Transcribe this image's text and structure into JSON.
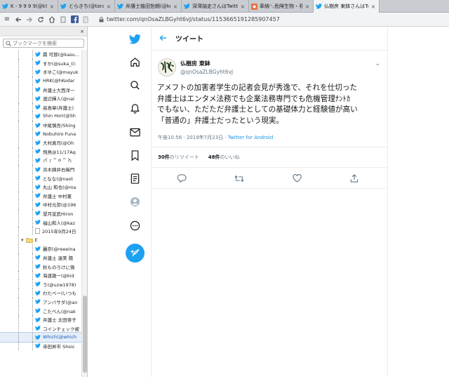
{
  "tabs": [
    {
      "title": "K - 9 9 9 9(@k9999... ",
      "icon": "twitter-icon",
      "active": false
    },
    {
      "title": "とらきち(@torakit0ex",
      "icon": "twitter-icon",
      "active": false
    },
    {
      "title": "弁護士植田哲朗(@ke",
      "icon": "twitter-icon",
      "active": false
    },
    {
      "title": "深澤諭史さんはTwitt",
      "icon": "twitter-icon",
      "active": false
    },
    {
      "title": "奉納＼危険生物・非ロ",
      "icon": "page-icon",
      "active": false
    },
    {
      "title": "仏樹房 東鉢さんはTw",
      "icon": "twitter-icon",
      "active": true
    }
  ],
  "url": "twitter.com/qnOsaZLBGyht6vJ/status/1153665191285907457",
  "sidebar": {
    "search_placeholder": "ブックマークを検索",
    "items": [
      {
        "label": "霧 可那(@kasu...",
        "type": "bookmark"
      },
      {
        "label": "すか(@suka_t):",
        "type": "bookmark"
      },
      {
        "label": "まゆこ(@mayuk",
        "type": "bookmark"
      },
      {
        "label": "HRK(@hKodar",
        "type": "bookmark"
      },
      {
        "label": "弁護士大西洋一",
        "type": "bookmark"
      },
      {
        "label": "渡辺輝人(@nal",
        "type": "bookmark"
      },
      {
        "label": "高島章(弁護士)",
        "type": "bookmark"
      },
      {
        "label": "Shin Hori(@Sh",
        "type": "bookmark"
      },
      {
        "label": "中尾慎吾/Shing",
        "type": "bookmark"
      },
      {
        "label": "Nobuhiro Funa",
        "type": "bookmark"
      },
      {
        "label": "大村真司(@Oh",
        "type": "bookmark"
      },
      {
        "label": "飛鳥@11/17Aq",
        "type": "bookmark"
      },
      {
        "label": "┌( ┌ ^ o ^ )┐",
        "type": "bookmark"
      },
      {
        "label": "浜木綿井右衛門",
        "type": "bookmark"
      },
      {
        "label": "となな(@naot",
        "type": "bookmark"
      },
      {
        "label": "丸山 和也(@ma",
        "type": "bookmark"
      },
      {
        "label": "弁護士 中村憲",
        "type": "bookmark"
      },
      {
        "label": "中村元弥(@196",
        "type": "bookmark"
      },
      {
        "label": "望月宣武Hiron",
        "type": "bookmark"
      },
      {
        "label": "福山和人(@kaz",
        "type": "bookmark"
      },
      {
        "label": "2015年9月24日",
        "type": "page"
      },
      {
        "label": "E",
        "type": "folder"
      },
      {
        "label": "麗奈(@reeeina",
        "type": "bookmark"
      },
      {
        "label": "弁護士 渥美 陽",
        "type": "bookmark"
      },
      {
        "label": "秋ものろけに微",
        "type": "bookmark"
      },
      {
        "label": "海渡雄一(@kid",
        "type": "bookmark"
      },
      {
        "label": "う(@uzw1978)",
        "type": "bookmark"
      },
      {
        "label": "わたべー(いつも",
        "type": "bookmark"
      },
      {
        "label": "アンバサダ(@an",
        "type": "bookmark"
      },
      {
        "label": "こたべん(@nak",
        "type": "bookmark"
      },
      {
        "label": "弁護士 太田啓子",
        "type": "bookmark"
      },
      {
        "label": "コインチェック被",
        "type": "bookmark"
      },
      {
        "label": "Which(@which",
        "type": "bookmark",
        "selected": true
      },
      {
        "label": "寺田昇市 Shoic",
        "type": "bookmark"
      }
    ]
  },
  "header": {
    "title": "ツイート"
  },
  "tweet": {
    "display_name": "仏樹房 東鉢",
    "username": "@qnOsaZLBGyht6vJ",
    "text": "アメフトの加害者学生の記者会見が秀逸で、それを仕切った\n弁護士はエンタメ法務でも企業法務専門でも危機管理ﾅﾝﾄｶ\nでもない、ただただ弁護士としての基礎体力と経験値が高い\n「普通の」弁護士だったという現実。",
    "time": "午後10:56 · 2019年7月23日 · ",
    "source": "Twitter for Android",
    "retweets_count": "30件",
    "retweets_label": "のリツイート",
    "likes_count": "48件",
    "likes_label": "のいいね"
  },
  "colors": {
    "twitter_blue": "#1da1f2",
    "text_primary": "#14171a",
    "text_secondary": "#657786"
  }
}
